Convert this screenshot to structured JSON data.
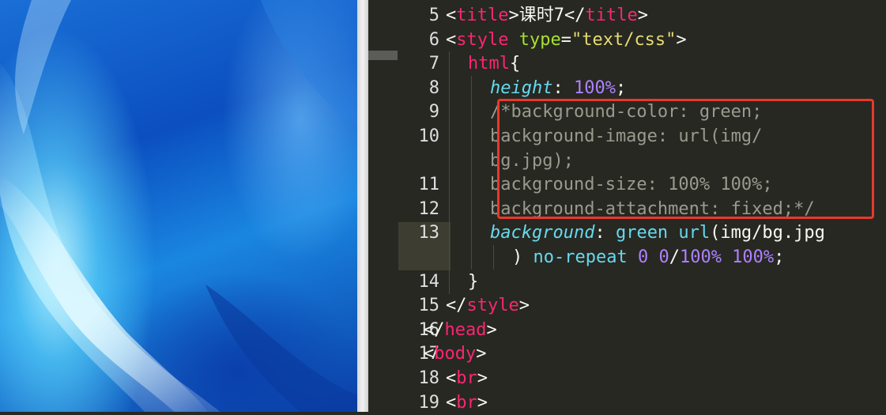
{
  "preview": {
    "caption": "",
    "wallpaper": "blue-abstract-wallpaper"
  },
  "editor": {
    "lines": [
      {
        "num": "5",
        "segments": [
          [
            "t-punct",
            "<"
          ],
          [
            "t-tag",
            "title"
          ],
          [
            "t-punct",
            ">"
          ],
          [
            "t-text",
            "课时7"
          ],
          [
            "t-punct",
            "</"
          ],
          [
            "t-tag",
            "title"
          ],
          [
            "t-punct",
            ">"
          ]
        ],
        "indent": 1
      },
      {
        "num": "6",
        "segments": [
          [
            "t-punct",
            "<"
          ],
          [
            "t-tag",
            "style"
          ],
          [
            "t-punct",
            " "
          ],
          [
            "t-attr",
            "type"
          ],
          [
            "t-punct",
            "="
          ],
          [
            "t-str",
            "\"text/css\""
          ],
          [
            "t-punct",
            ">"
          ]
        ],
        "indent": 1
      },
      {
        "num": "7",
        "segments": [
          [
            "t-tag",
            "html"
          ],
          [
            "t-punct",
            "{"
          ]
        ],
        "indent": 2
      },
      {
        "num": "8",
        "segments": [
          [
            "t-prop",
            "height"
          ],
          [
            "t-punct",
            ": "
          ],
          [
            "t-num",
            "100%"
          ],
          [
            "t-punct",
            ";"
          ]
        ],
        "indent": 3
      },
      {
        "num": "9",
        "segments": [
          [
            "t-comment",
            "/*background-color: green;"
          ]
        ],
        "indent": 3
      },
      {
        "num": "10",
        "segments": [
          [
            "t-comment",
            "background-image: url(img/"
          ]
        ],
        "indent": 3
      },
      {
        "num": "",
        "segments": [
          [
            "t-comment",
            "bg.jpg);"
          ]
        ],
        "indent": 3
      },
      {
        "num": "11",
        "segments": [
          [
            "t-comment",
            "background-size: 100% 100%;"
          ]
        ],
        "indent": 3
      },
      {
        "num": "12",
        "segments": [
          [
            "t-comment",
            "background-attachment: fixed;*/"
          ]
        ],
        "indent": 3
      },
      {
        "num": "13",
        "segments": [
          [
            "t-prop",
            "background"
          ],
          [
            "t-punct",
            ": "
          ],
          [
            "t-val",
            "green url"
          ],
          [
            "t-punct",
            "(img/bg.jpg"
          ]
        ],
        "indent": 3
      },
      {
        "num": "",
        "segments": [
          [
            "t-punct",
            ") "
          ],
          [
            "t-val",
            "no-repeat "
          ],
          [
            "t-num",
            "0 0"
          ],
          [
            "t-punct",
            "/"
          ],
          [
            "t-num",
            "100% 100%"
          ],
          [
            "t-punct",
            ";"
          ]
        ],
        "indent": 4
      },
      {
        "num": "14",
        "segments": [
          [
            "t-punct",
            "}"
          ]
        ],
        "indent": 2
      },
      {
        "num": "15",
        "segments": [
          [
            "t-punct",
            "</"
          ],
          [
            "t-tag",
            "style"
          ],
          [
            "t-punct",
            ">"
          ]
        ],
        "indent": 1
      },
      {
        "num": "16",
        "segments": [
          [
            "t-punct",
            "</"
          ],
          [
            "t-tag",
            "head"
          ],
          [
            "t-punct",
            ">"
          ]
        ],
        "indent": 0
      },
      {
        "num": "17",
        "segments": [
          [
            "t-punct",
            "<"
          ],
          [
            "t-tag",
            "body"
          ],
          [
            "t-punct",
            ">"
          ]
        ],
        "indent": 0
      },
      {
        "num": "18",
        "segments": [
          [
            "t-punct",
            "<"
          ],
          [
            "t-tag",
            "br"
          ],
          [
            "t-punct",
            ">"
          ]
        ],
        "indent": 1
      },
      {
        "num": "19",
        "segments": [
          [
            "t-punct",
            "<"
          ],
          [
            "t-tag",
            "br"
          ],
          [
            "t-punct",
            ">"
          ]
        ],
        "indent": 1
      }
    ],
    "colors": {
      "background": "#272822",
      "tag": "#f92672",
      "attribute": "#a6e22e",
      "string": "#e6db74",
      "property": "#66d9ef",
      "number": "#ae81ff",
      "comment": "#9a9a8e",
      "highlight_border": "#e8392b"
    }
  }
}
